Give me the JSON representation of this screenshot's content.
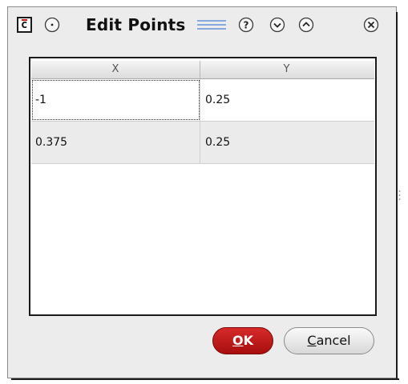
{
  "window": {
    "title": "Edit Points"
  },
  "titlebar": {
    "icons": [
      "app-icon",
      "menu-dot-icon",
      "grip-lines-icon",
      "help-icon",
      "shade-down-icon",
      "maximize-up-icon",
      "close-icon"
    ],
    "app_icon_glyph": "c",
    "help_glyph": "?"
  },
  "table": {
    "columns": [
      "X",
      "Y"
    ],
    "rows": [
      {
        "x": "-1",
        "y": "0.25"
      },
      {
        "x": "0.375",
        "y": "0.25"
      }
    ]
  },
  "buttons": {
    "ok_mnemonic": "O",
    "ok_rest": "K",
    "cancel_mnemonic": "C",
    "cancel_rest": "ancel"
  },
  "colors": {
    "ok_button": "#c21a1a",
    "window_bg": "#ececec",
    "alt_row": "#ebebeb"
  }
}
